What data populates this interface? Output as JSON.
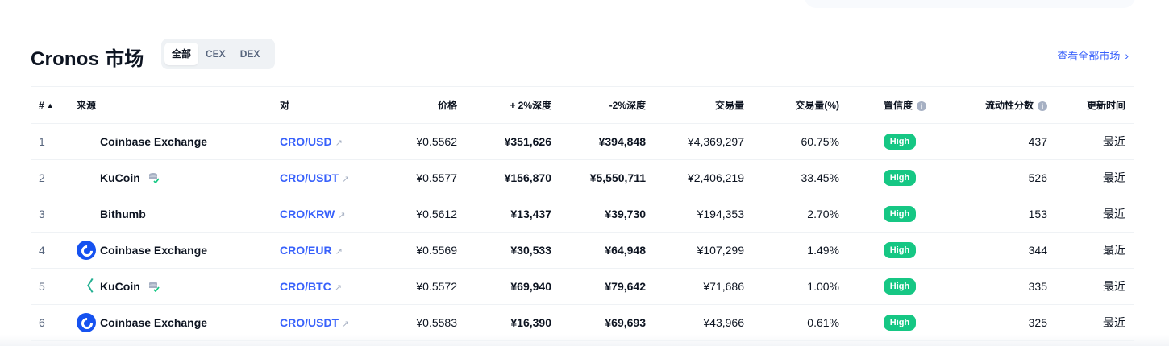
{
  "header": {
    "title": "Cronos 市场",
    "tabs": [
      {
        "label": "全部",
        "active": true
      },
      {
        "label": "CEX",
        "active": false
      },
      {
        "label": "DEX",
        "active": false
      }
    ],
    "view_all": "查看全部市场",
    "view_all_icon": "chevron-right-icon"
  },
  "columns": {
    "rank": "#",
    "source": "来源",
    "pair": "对",
    "price": "价格",
    "depth_plus": "+ 2%深度",
    "depth_minus": "-2%深度",
    "volume": "交易量",
    "volume_pct": "交易量(%)",
    "confidence": "置信度",
    "liquidity": "流动性分数",
    "updated": "更新时间"
  },
  "colors": {
    "accent": "#3861fb",
    "high_badge": "#16c784",
    "muted": "#58667e",
    "coinbase": "#1652f0",
    "kucoin": "#23af91"
  },
  "rows": [
    {
      "rank": "1",
      "source": "Coinbase Exchange",
      "logo": "none",
      "pair": "CRO/USD",
      "price": "¥0.5562",
      "depth_plus": "¥351,626",
      "depth_minus": "¥394,848",
      "volume": "¥4,369,297",
      "volume_pct": "60.75%",
      "confidence": "High",
      "liquidity": "437",
      "updated": "最近"
    },
    {
      "rank": "2",
      "source": "KuCoin",
      "logo": "none",
      "por_icon": true,
      "pair": "CRO/USDT",
      "price": "¥0.5577",
      "depth_plus": "¥156,870",
      "depth_minus": "¥5,550,711",
      "volume": "¥2,406,219",
      "volume_pct": "33.45%",
      "confidence": "High",
      "liquidity": "526",
      "updated": "最近"
    },
    {
      "rank": "3",
      "source": "Bithumb",
      "logo": "none",
      "pair": "CRO/KRW",
      "price": "¥0.5612",
      "depth_plus": "¥13,437",
      "depth_minus": "¥39,730",
      "volume": "¥194,353",
      "volume_pct": "2.70%",
      "confidence": "High",
      "liquidity": "153",
      "updated": "最近"
    },
    {
      "rank": "4",
      "source": "Coinbase Exchange",
      "logo": "coinbase-logo",
      "pair": "CRO/EUR",
      "price": "¥0.5569",
      "depth_plus": "¥30,533",
      "depth_minus": "¥64,948",
      "volume": "¥107,299",
      "volume_pct": "1.49%",
      "confidence": "High",
      "liquidity": "344",
      "updated": "最近"
    },
    {
      "rank": "5",
      "source": "KuCoin",
      "logo": "kucoin-logo",
      "por_icon": true,
      "pair": "CRO/BTC",
      "price": "¥0.5572",
      "depth_plus": "¥69,940",
      "depth_minus": "¥79,642",
      "volume": "¥71,686",
      "volume_pct": "1.00%",
      "confidence": "High",
      "liquidity": "335",
      "updated": "最近"
    },
    {
      "rank": "6",
      "source": "Coinbase Exchange",
      "logo": "coinbase-logo",
      "pair": "CRO/USDT",
      "price": "¥0.5583",
      "depth_plus": "¥16,390",
      "depth_minus": "¥69,693",
      "volume": "¥43,966",
      "volume_pct": "0.61%",
      "confidence": "High",
      "liquidity": "325",
      "updated": "最近"
    }
  ]
}
